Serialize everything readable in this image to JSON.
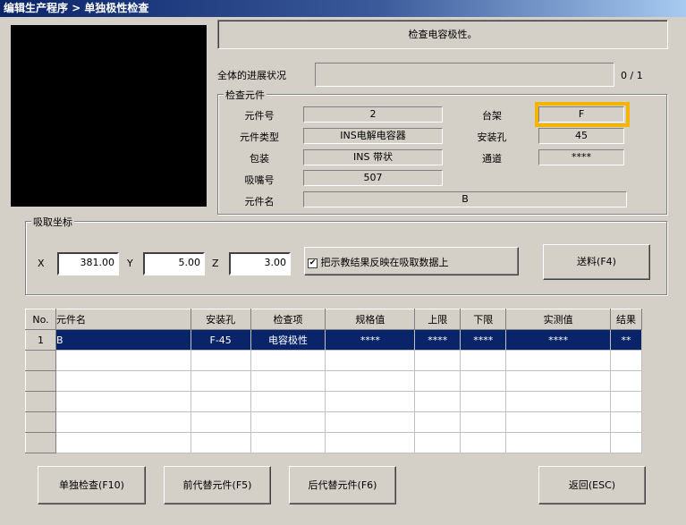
{
  "title": "编辑生产程序 > 单独极性检查",
  "message": "检查电容极性。",
  "progress": {
    "label": "全体的进展状况",
    "value": 0,
    "total": 1,
    "text": "0 / 1"
  },
  "component": {
    "group_title": "检查元件",
    "part_no_label": "元件号",
    "part_no": "2",
    "part_type_label": "元件类型",
    "part_type": "INS电解电容器",
    "package_label": "包装",
    "package": "INS 带状",
    "nozzle_label": "吸嘴号",
    "nozzle": "507",
    "name_label": "元件名",
    "name": "B",
    "rack_label": "台架",
    "rack": "F",
    "hole_label": "安装孔",
    "hole": "45",
    "channel_label": "通道",
    "channel": "****"
  },
  "pickup": {
    "group_title": "吸取坐标",
    "x_label": "X",
    "x": "381.00",
    "y_label": "Y",
    "y": "5.00",
    "z_label": "Z",
    "z": "3.00",
    "checkbox_label": "把示教结果反映在吸取数据上",
    "checkbox_checked": true,
    "feed_button": "送料(F4)"
  },
  "table": {
    "headers": [
      "No.",
      "元件名",
      "安装孔",
      "检查项",
      "规格值",
      "上限",
      "下限",
      "实测值",
      "结果"
    ],
    "rows": [
      [
        "1",
        "B",
        "F-45",
        "电容极性",
        "****",
        "****",
        "****",
        "****",
        "**"
      ]
    ]
  },
  "buttons": {
    "single_check": "单独检查(F10)",
    "prev_alt": "前代替元件(F5)",
    "next_alt": "后代替元件(F6)",
    "back": "返回(ESC)"
  },
  "colors": {
    "highlight": "#f5b400",
    "selection": "#0a246a"
  }
}
